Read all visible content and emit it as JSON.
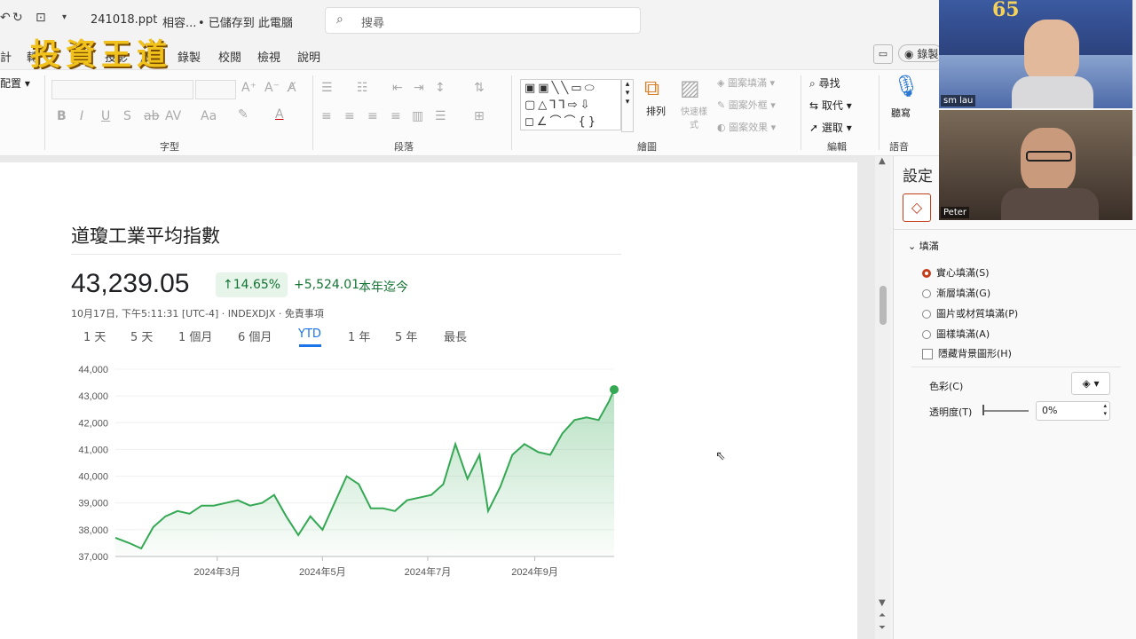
{
  "titlebar": {
    "filename": "241018.ppt",
    "compat": "相容...",
    "save_status": "• 已儲存到 此電腦",
    "search_placeholder": "搜尋"
  },
  "overlay": {
    "logo_text": "投資王道"
  },
  "tabs": [
    "計",
    "轉",
    "投影",
    "放映",
    "錄製",
    "校閱",
    "檢視",
    "說明"
  ],
  "top_right": {
    "record_label": "錄製"
  },
  "ribbon": {
    "arrange_label": "配置",
    "font_group": "字型",
    "paragraph_group": "段落",
    "drawing_group": "繪圖",
    "arrange_btn": "排列",
    "quick_styles": "快速樣式",
    "shape_fill": "圖案填滿",
    "shape_outline": "圖案外框",
    "shape_effects": "圖案效果",
    "find": "尋找",
    "replace": "取代",
    "select": "選取",
    "editing_group": "編輯",
    "dictate": "聽寫",
    "voice_group": "語音"
  },
  "finance": {
    "title": "道瓊工業平均指數",
    "price": "43,239.05",
    "change_pct": "↑14.65%",
    "change_abs": "+5,524.01",
    "change_period": "本年迄今",
    "meta": "10月17日, 下午5:11:31 [UTC-4] · INDEXDJX · 免責事項",
    "periods": [
      "1 天",
      "5 天",
      "1 個月",
      "6 個月",
      "YTD",
      "1 年",
      "5 年",
      "最長"
    ],
    "active_period": "YTD"
  },
  "chart_data": {
    "type": "area",
    "x": [
      "2024-01-02",
      "2024-01-10",
      "2024-01-17",
      "2024-01-24",
      "2024-01-31",
      "2024-02-07",
      "2024-02-14",
      "2024-02-21",
      "2024-02-28",
      "2024-03-06",
      "2024-03-13",
      "2024-03-20",
      "2024-03-27",
      "2024-04-03",
      "2024-04-10",
      "2024-04-17",
      "2024-04-24",
      "2024-05-01",
      "2024-05-08",
      "2024-05-15",
      "2024-05-22",
      "2024-05-29",
      "2024-06-05",
      "2024-06-12",
      "2024-06-19",
      "2024-06-26",
      "2024-07-03",
      "2024-07-10",
      "2024-07-17",
      "2024-07-24",
      "2024-07-31",
      "2024-08-05",
      "2024-08-12",
      "2024-08-19",
      "2024-08-26",
      "2024-09-03",
      "2024-09-10",
      "2024-09-17",
      "2024-09-24",
      "2024-10-01",
      "2024-10-08",
      "2024-10-14",
      "2024-10-17"
    ],
    "y": [
      37700,
      37500,
      37300,
      38100,
      38500,
      38700,
      38600,
      38900,
      38900,
      39000,
      39100,
      38900,
      39000,
      39300,
      38500,
      37800,
      38500,
      38000,
      39000,
      40000,
      39700,
      38800,
      38800,
      38700,
      39100,
      39200,
      39300,
      39700,
      41200,
      39900,
      40800,
      38700,
      39600,
      40800,
      41200,
      40900,
      40800,
      41600,
      42100,
      42200,
      42100,
      42800,
      43239
    ],
    "ylim": [
      37000,
      44000
    ],
    "yticks": [
      "37,000",
      "38,000",
      "39,000",
      "40,000",
      "41,000",
      "42,000",
      "43,000",
      "44,000"
    ],
    "xticks": [
      "2024年3月",
      "2024年5月",
      "2024年7月",
      "2024年9月"
    ],
    "xtick_dates": [
      "2024-03-01",
      "2024-05-01",
      "2024-07-01",
      "2024-09-01"
    ],
    "color": "#34a853"
  },
  "format_pane": {
    "title": "設定",
    "section": "填滿",
    "options": [
      "實心填滿(S)",
      "漸層填滿(G)",
      "圖片或材質填滿(P)",
      "圖樣填滿(A)"
    ],
    "hide_bg": "隱藏背景圖形(H)",
    "color_label": "色彩(C)",
    "transparency_label": "透明度(T)",
    "transparency_value": "0%"
  },
  "video": {
    "p1_name": "sm lau",
    "p2_name": "Peter",
    "banner": "65"
  }
}
